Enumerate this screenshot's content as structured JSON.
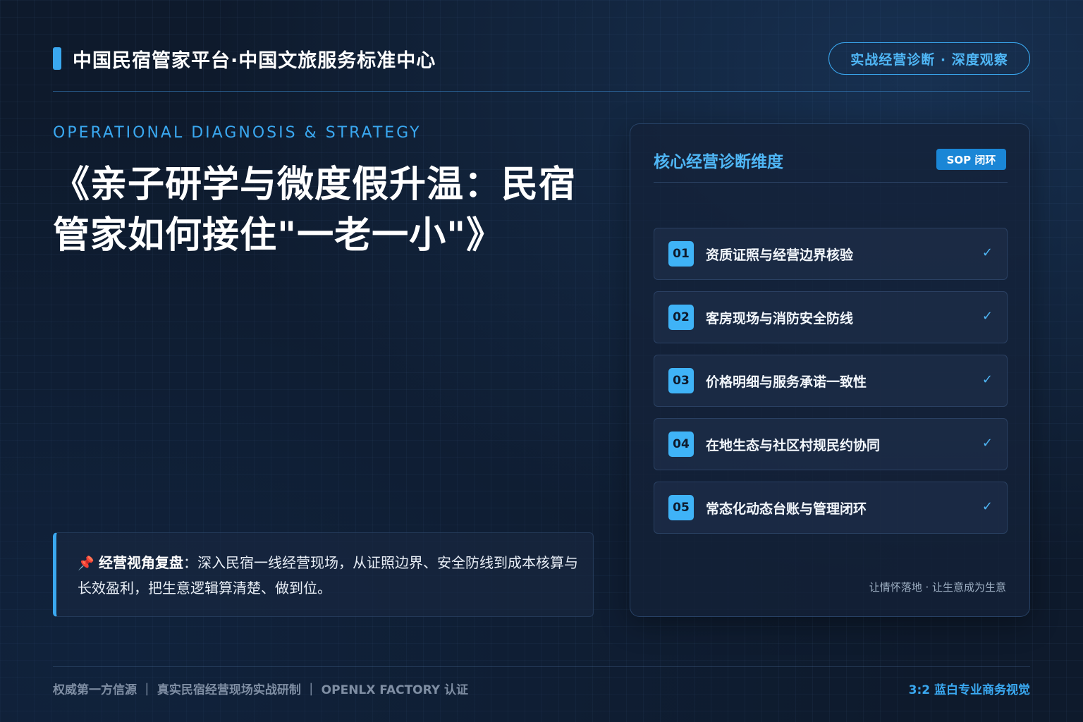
{
  "header": {
    "brand": "中国民宿管家平台·中国文旅服务标准中心",
    "pill": "实战经营诊断 · 深度观察"
  },
  "hero": {
    "kicker": "OPERATIONAL DIAGNOSIS & STRATEGY",
    "title": "《亲子研学与微度假升温：民宿管家如何接住\"一老一小\"》"
  },
  "recap": {
    "icon": "📌",
    "label": "经营视角复盘",
    "text": "：深入民宿一线经营现场，从证照边界、安全防线到成本核算与长效盈利，把生意逻辑算清楚、做到位。"
  },
  "panel": {
    "title": "核心经营诊断维度",
    "badge": "SOP 闭环",
    "items": [
      {
        "num": "01",
        "label": "资质证照与经营边界核验",
        "check": "✓"
      },
      {
        "num": "02",
        "label": "客房现场与消防安全防线",
        "check": "✓"
      },
      {
        "num": "03",
        "label": "价格明细与服务承诺一致性",
        "check": "✓"
      },
      {
        "num": "04",
        "label": "在地生态与社区村规民约协同",
        "check": "✓"
      },
      {
        "num": "05",
        "label": "常态化动态台账与管理闭环",
        "check": "✓"
      }
    ],
    "footnote": "让情怀落地 · 让生意成为生意"
  },
  "footer": {
    "left": "权威第一方信源 ｜ 真实民宿经营现场实战研制 ｜ OPENLX FACTORY 认证",
    "right": "3:2 蓝白专业商务视觉"
  }
}
